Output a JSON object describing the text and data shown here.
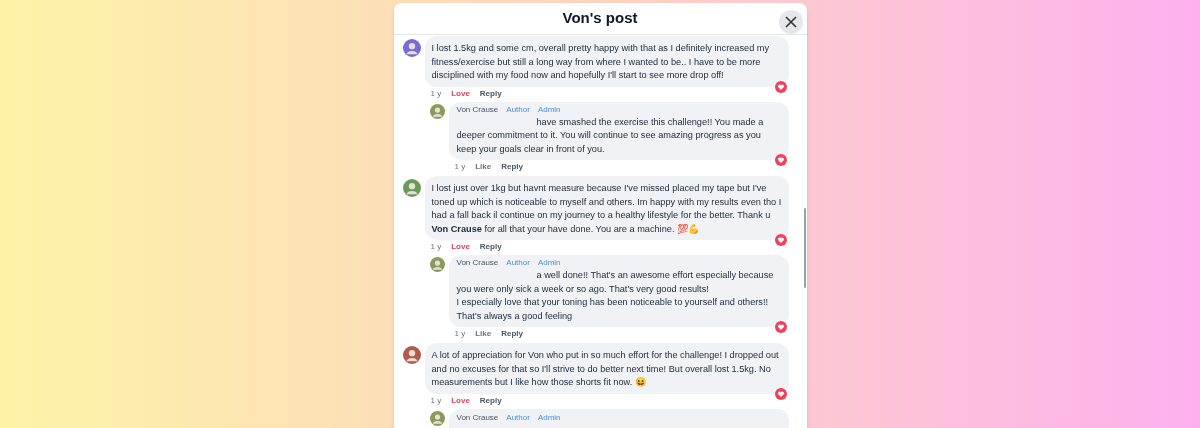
{
  "dialog": {
    "title": "Von's post"
  },
  "comments": [
    {
      "kind": "comment",
      "text": "I lost 1.5kg and some cm, overall pretty happy with that as I definitely increased my fitness/exercise but still a long way from where I wanted to be.. I have to be more disciplined with my food now and hopefully I'll start to see more drop off!",
      "time": "1 y",
      "reaction": "Love",
      "reacted": true,
      "reply": "Reply"
    },
    {
      "kind": "reply",
      "name": "Von Crause",
      "badges": [
        "Author",
        "Admin"
      ],
      "text": "have smashed the exercise this challenge!! You made a deeper commitment to it. You will continue to see amazing progress as you keep your goals clear in front of you.",
      "time": "1 y",
      "reaction": "Like",
      "reacted": false,
      "reply": "Reply"
    },
    {
      "kind": "comment",
      "text": "I lost just over 1kg but havnt measure because I've missed placed my tape but I've toned up which is noticeable to myself and others. Im happy with my results even tho I had a fall back il continue on my journey to a healthy lifestyle for the better. Thank u **Von Crause** for all that your have done. You are a machine. 💯💪",
      "time": "1 y",
      "reaction": "Love",
      "reacted": true,
      "reply": "Reply"
    },
    {
      "kind": "reply",
      "name": "Von Crause",
      "badges": [
        "Author",
        "Admin"
      ],
      "text": "a well done!! That's an awesome effort especially because you were only sick a week or so ago. That's very good results!\nI especially love that your toning has been noticeable to yourself and others!! That's always a good feeling",
      "time": "1 y",
      "reaction": "Like",
      "reacted": false,
      "reply": "Reply"
    },
    {
      "kind": "comment",
      "text": "A lot of appreciation for Von who put in so much effort for the challenge! I dropped out and no excuses for that so I'll strive to do better next time! But overall lost 1.5kg. No measurements but I like how those shorts fit now. 😆",
      "time": "1 y",
      "reaction": "Love",
      "reacted": true,
      "reply": "Reply"
    },
    {
      "kind": "reply_header",
      "name": "Von Crause",
      "badges": [
        "Author",
        "Admin"
      ]
    }
  ]
}
